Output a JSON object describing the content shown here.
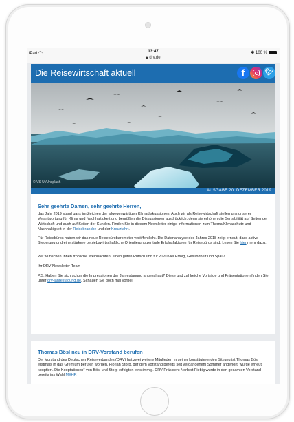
{
  "status_bar": {
    "device": "iPad",
    "time": "13:47",
    "url": "drv.de",
    "battery": "100 %"
  },
  "header": {
    "title": "Die Reisewirtschaft aktuell",
    "social": [
      "facebook-icon",
      "instagram-icon",
      "twitter-icon"
    ],
    "accent_color": "#1d6db0"
  },
  "hero": {
    "credit": "© VS Ut/Unsplash",
    "date_label": "AUSGABE 20. DEZEMBER 2019"
  },
  "letter": {
    "greeting": "Sehr geehrte Damen, sehr geehrte Herren,",
    "p1": "das Jahr 2019 stand ganz im Zeichen der allgegenwärtigen Klimadiskussionen. Auch wir als Reisewirtschaft stellen uns unserer Verantwortung für Klima und Nachhaltigkeit und begrüßen die Diskussionen ausdrücklich, denn sie erhöhen die Sensibilität auf Seiten der Wirtschaft und auch auf Seiten der Kunden. Finden Sie in diesem Newsletter einige Informationen zum Thema Klimaschutz und Nachhaltigkeit in der ",
    "p1_link1": "Reisebranche",
    "p1_mid": " und der ",
    "p1_link2": "Kreuzfahrt",
    "p1_end": ".",
    "p2": "Für Reisebüros haben wir das neue Reisebürobarometer veröffentlicht. Die Datenanalyse des Jahres 2018 zeigt erneut, dass aktive Steuerung und eine stärkere betriebswirtschaftliche Orientierung zentrale Erfolgsfaktoren für Reisebüros sind. Lesen Sie ",
    "p2_link": "hier",
    "p2_end": " mehr dazu.",
    "p3": "Wir wünschen Ihnen fröhliche Weihnachten, einen guten Rutsch und für 2020 viel Erfolg, Gesundheit und Spaß!",
    "p4": "Ihr DRV-Newsletter-Team",
    "p5": "P.S. Haben Sie sich schon die Impressionen der Jahrestagung angeschaut? Diese und zahlreiche Vorträge und Präsentationen finden Sie unter ",
    "p5_link": "drv-jahrestagung.de",
    "p5_end": ". Schauen Sie doch mal vorbei."
  },
  "article": {
    "title": "Thomas Bösl neu in DRV-Vorstand berufen",
    "text": "Der Vorstand des Deutschen Reiseverbandes (DRV) hat zwei weitere Mitglieder: In seiner konstituierenden Sitzung ist Thomas Bösl erstmals in das Gremium berufen worden. Florian Storp, der dem Vorstand bereits seit vergangenem Sommer angehört, wurde erneut kooptiert. Die Kooptationen* von Bösl und Storp erfolgten einstimmig. DRV-Präsident Norbert Fiebig wurde in den gesamten Vorstand bereits ins Wahl ",
    "link": "MEHR"
  }
}
